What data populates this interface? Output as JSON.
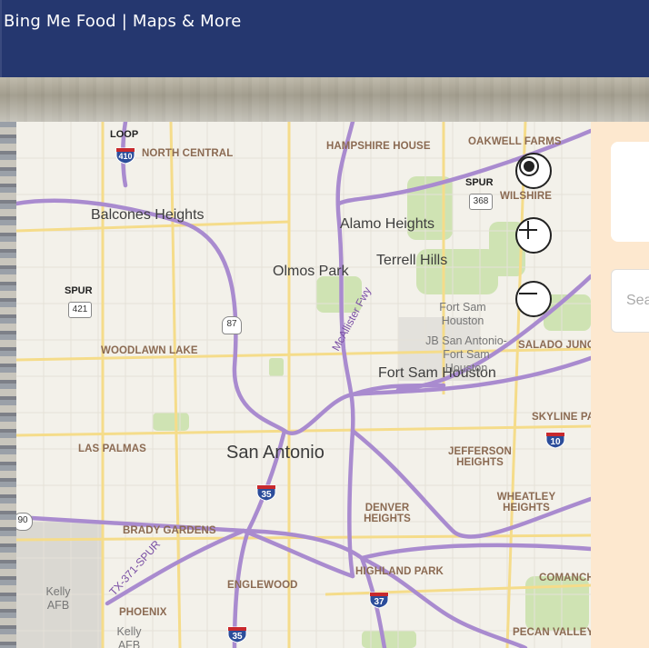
{
  "header": {
    "title": "Bing Me Food | Maps & More"
  },
  "map": {
    "city": "San Antonio",
    "areas": [
      "Balcones Heights",
      "Alamo Heights",
      "Olmos Park",
      "Terrell Hills",
      "Fort Sam Houston"
    ],
    "neighborhoods": [
      "NORTH CENTRAL",
      "HAMPSHIRE HOUSE",
      "OAKWELL FARMS",
      "WILSHIRE",
      "WOODLAWN LAKE",
      "SALADO JUNCTION",
      "SKYLINE PA",
      "LAS PALMAS",
      "JEFFERSON HEIGHTS",
      "WHEATLEY HEIGHTS",
      "DENVER HEIGHTS",
      "BRADY GARDENS",
      "HIGHLAND PARK",
      "ENGLEWOOD",
      "COMANCH",
      "PHOENIX",
      "PECAN VALLEY"
    ],
    "gray_labels": [
      "Fort Sam Houston",
      "JB San Antonio-Fort Sam Houston",
      "Kelly AFB",
      "Kelly AFB"
    ],
    "road_labels": [
      "McAllister Fwy",
      "TX-371-SPUR"
    ],
    "shields": {
      "loop": "LOOP",
      "loop_num": "410",
      "spur1": "SPUR",
      "spur1_num": "368",
      "spur2": "SPUR",
      "spur2_num": "421",
      "us87": "87",
      "i35a": "35",
      "i35b": "35",
      "i10": "10",
      "i37": "37",
      "r90": "90"
    },
    "controls": {
      "locate": "locate-icon",
      "zoom_in": "plus-icon",
      "zoom_out": "minus-icon"
    }
  },
  "panel": {
    "search_placeholder": "Search"
  },
  "colors": {
    "header": "#25376f",
    "panel": "#fde8cf",
    "highway": "#a98bcf",
    "park": "#cfe3b3"
  }
}
